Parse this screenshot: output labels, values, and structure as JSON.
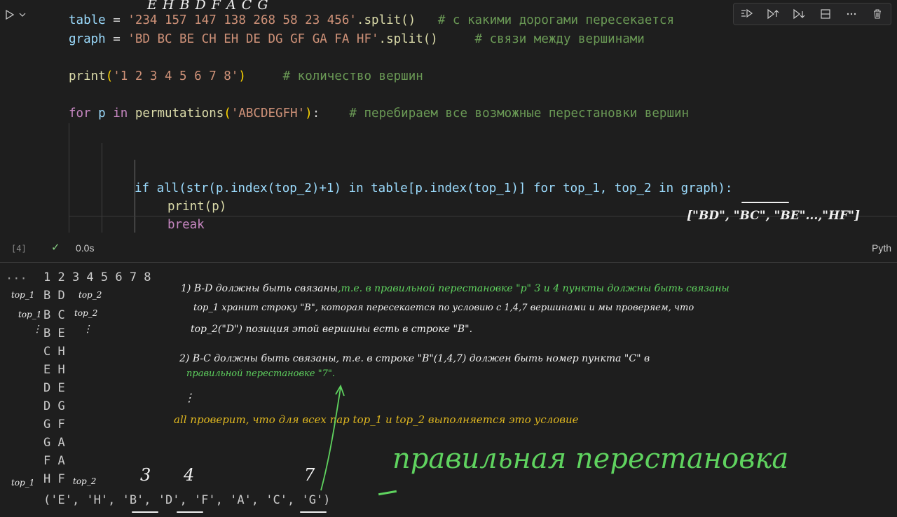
{
  "cell": {
    "execution_count": "[4]",
    "status_check": "✓",
    "duration": "0.0s",
    "language": "Pyth"
  },
  "toolbar": {
    "buttons": [
      "run-by-line",
      "execute-above",
      "execute-below",
      "split-cell",
      "more-actions",
      "delete-cell"
    ]
  },
  "code": {
    "line1_var": "table",
    "line1_str": "'234 157 147 138 268 58 23 456'",
    "line1_method": ".split()",
    "line1_comment": "# с какими дорогами пересекается",
    "line2_var": "graph",
    "line2_str": "'BD BC BE CH EH DE DG GF GA FA HF'",
    "line2_method": ".split()",
    "line2_comment": "# связи между вершинами",
    "line3_str": "'1 2 3 4 5 6 7 8'",
    "line3_comment": "# количество вершин",
    "line4_str": "'ABCDEGFH'",
    "line4_comment": "# перебираем все возможные перестановки вершин",
    "line5_text": "if all(str(p.index(top_2)+1) in table[p.index(top_1)] for top_1, top_2 in graph):",
    "line6_text": "print(p)",
    "line7_text": "break"
  },
  "output": {
    "ellipsis": "···",
    "header": "1 2 3 4 5 6 7 8",
    "pairs": [
      "B D",
      "B C",
      "B E",
      "C H",
      "E H",
      "D E",
      "D G",
      "G F",
      "G A",
      "F A",
      "H F"
    ],
    "result": "('E', 'H', 'B', 'D', 'F', 'A', 'C', 'G')"
  },
  "handwriting": {
    "top_letters": "E   H   B   D   F   A   C   G",
    "graph_note": "[\"BD\", \"BC\", \"BE\"...,\"HF\"]",
    "side_top1_a": "top_1",
    "side_top2_a": "top_2",
    "side_top1_b": "top_1",
    "side_top2_b": "top_2",
    "side_top1_c": "top_1",
    "side_top2_c": "top_2",
    "note1_w": "1) B-D должны быть связаны",
    "note1_g": ",т.е. в правильной перестановке \"р\" 3 и 4 пункты должны быть связаны",
    "note2_w": "top_1 хранит строку \"B\", которая пересекается по условию с 1,4,7 вершинами и мы проверяем, что",
    "note3_w": "top_2(\"D\") позиция этой вершины есть в строке \"B\".",
    "note4_w": "2) B-C должны быть связаны, т.е. в строке \"B\"(1,4,7) должен быть номер пункта \"C\" в",
    "note4_g": "правильной перестановке \"7\".",
    "note5_y": "all проверит, что для всех пар top_1 и top_2 выполняется это условие",
    "big_note": "правильная перестановка",
    "num_3": "3",
    "num_4": "4",
    "num_7": "7"
  }
}
